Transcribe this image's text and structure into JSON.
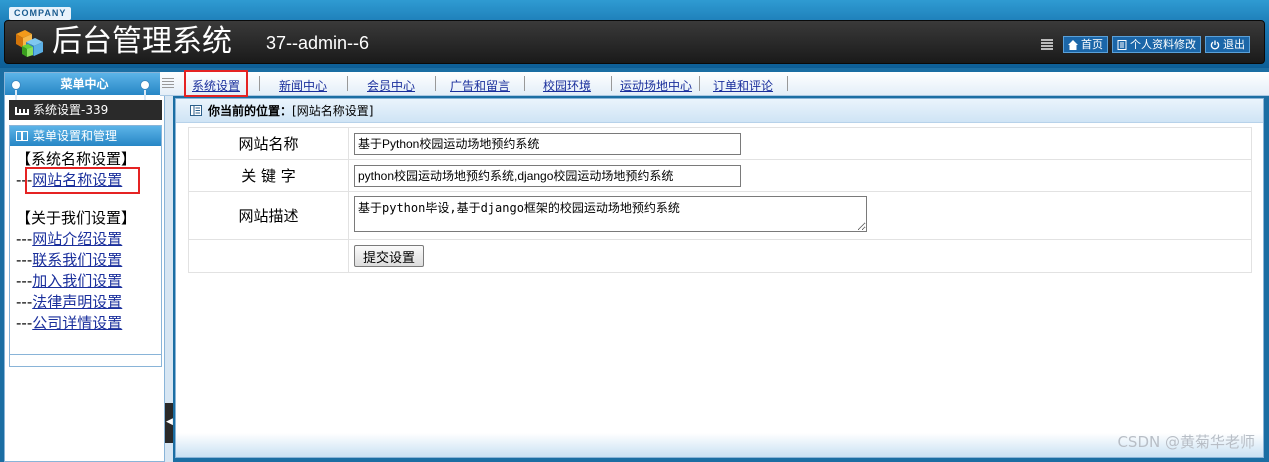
{
  "header": {
    "company": "COMPANY",
    "title": "后台管理系统",
    "user_info": "37--admin--6",
    "buttons": [
      {
        "label": "首页",
        "icon": "home-icon"
      },
      {
        "label": "个人资料修改",
        "icon": "profile-icon"
      },
      {
        "label": "退出",
        "icon": "power-icon"
      }
    ]
  },
  "sidebar": {
    "menu_center": "菜单中心",
    "system_bar": "系统设置-339",
    "menu_box_title": "菜单设置和管理",
    "groups": [
      {
        "title": "【系统名称设置】",
        "prefix": "---",
        "links": [
          "网站名称设置"
        ]
      },
      {
        "title": "【关于我们设置】",
        "prefix": "---",
        "links": [
          "网站介绍设置",
          "联系我们设置",
          "加入我们设置",
          "法律声明设置",
          "公司详情设置"
        ]
      }
    ]
  },
  "topnav": {
    "items": [
      "系统设置",
      "新闻中心",
      "会员中心",
      "广告和留言",
      "校园环境",
      "运动场地中心",
      "订单和评论"
    ]
  },
  "content": {
    "breadcrumb_label": "你当前的位置：",
    "breadcrumb_value": "[网站名称设置]",
    "fields": {
      "site_name_label": "网站名称",
      "site_name_value": "基于Python校园运动场地预约系统",
      "keywords_label": "关 键 字",
      "keywords_value": "python校园运动场地预约系统,django校园运动场地预约系统",
      "description_label": "网站描述",
      "description_value": "基于python毕设,基于django框架的校园运动场地预约系统"
    },
    "submit_label": "提交设置"
  },
  "watermark": "CSDN @黄菊华老师",
  "colors": {
    "accent_red": "#e52323",
    "link_blue": "#1a2f9c",
    "header_blue": "#1a78b3"
  }
}
